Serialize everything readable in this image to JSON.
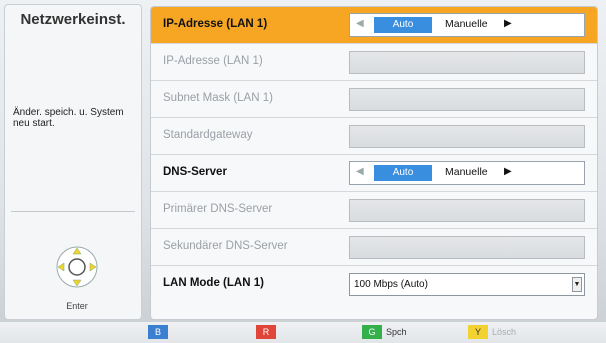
{
  "side": {
    "title": "Netzwerkeinst.",
    "message": "Änder. speich. u. System neu start.",
    "enter_label": "Enter"
  },
  "settings": [
    {
      "label": "IP-Adresse (LAN 1)",
      "control": "toggle",
      "selected": true,
      "enabled": true,
      "auto": "Auto",
      "manual": "Manuelle"
    },
    {
      "label": "IP-Adresse (LAN 1)",
      "control": "field",
      "enabled": false
    },
    {
      "label": "Subnet Mask (LAN 1)",
      "control": "field",
      "enabled": false
    },
    {
      "label": "Standardgateway",
      "control": "field",
      "enabled": false
    },
    {
      "label": "DNS-Server",
      "control": "toggle",
      "enabled": true,
      "auto": "Auto",
      "manual": "Manuelle"
    },
    {
      "label": "Primärer DNS-Server",
      "control": "field",
      "enabled": false
    },
    {
      "label": "Sekundärer DNS-Server",
      "control": "field",
      "enabled": false
    },
    {
      "label": "LAN Mode (LAN 1)",
      "control": "select",
      "enabled": true,
      "value": "100 Mbps (Auto)"
    }
  ],
  "color_buttons": [
    {
      "key": "B",
      "label": "",
      "color": "#3a7fd0"
    },
    {
      "key": "R",
      "label": "",
      "color": "#e0453a"
    },
    {
      "key": "G",
      "label": "Spch",
      "color": "#34b04a"
    },
    {
      "key": "Y",
      "label": "Lösch",
      "color": "#f2d230"
    }
  ]
}
